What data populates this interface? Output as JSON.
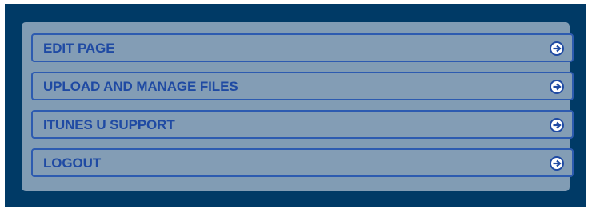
{
  "menu": {
    "items": [
      {
        "label": "EDIT PAGE",
        "icon": "arrow-right-circle-icon"
      },
      {
        "label": "UPLOAD AND MANAGE FILES",
        "icon": "arrow-right-circle-icon"
      },
      {
        "label": "ITUNES U SUPPORT",
        "icon": "arrow-right-circle-icon"
      },
      {
        "label": "LOGOUT",
        "icon": "arrow-right-circle-icon"
      }
    ]
  },
  "colors": {
    "background": "#003a66",
    "panel": "#819cb4",
    "accent": "#1f4aa3"
  }
}
